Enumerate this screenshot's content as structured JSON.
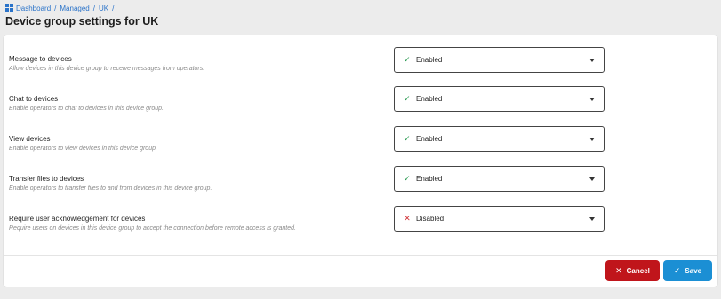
{
  "breadcrumb": {
    "items": [
      "Dashboard",
      "Managed",
      "UK"
    ],
    "separator": "/"
  },
  "page_title": "Device group settings for UK",
  "settings": [
    {
      "title": "Message to devices",
      "description": "Allow devices in this device group to receive messages from operators.",
      "value": "Enabled",
      "icon": "check-icon"
    },
    {
      "title": "Chat to devices",
      "description": "Enable operators to chat to devices in this device group.",
      "value": "Enabled",
      "icon": "check-icon"
    },
    {
      "title": "View devices",
      "description": "Enable operators to view devices in this device group.",
      "value": "Enabled",
      "icon": "check-icon"
    },
    {
      "title": "Transfer files to devices",
      "description": "Enable operators to transfer files to and from devices in this device group.",
      "value": "Enabled",
      "icon": "check-icon"
    },
    {
      "title": "Require user acknowledgement for devices",
      "description": "Require users on devices in this device group to accept the connection before remote access is granted.",
      "value": "Disabled",
      "icon": "x-icon"
    }
  ],
  "actions": {
    "cancel_label": "Cancel",
    "save_label": "Save"
  },
  "colors": {
    "link": "#2a73c9",
    "enabled": "#2e9c55",
    "disabled": "#d13438",
    "cancel": "#c0151b",
    "save": "#1b8fd4"
  },
  "glyphs": {
    "check": "✓",
    "x": "✕"
  }
}
